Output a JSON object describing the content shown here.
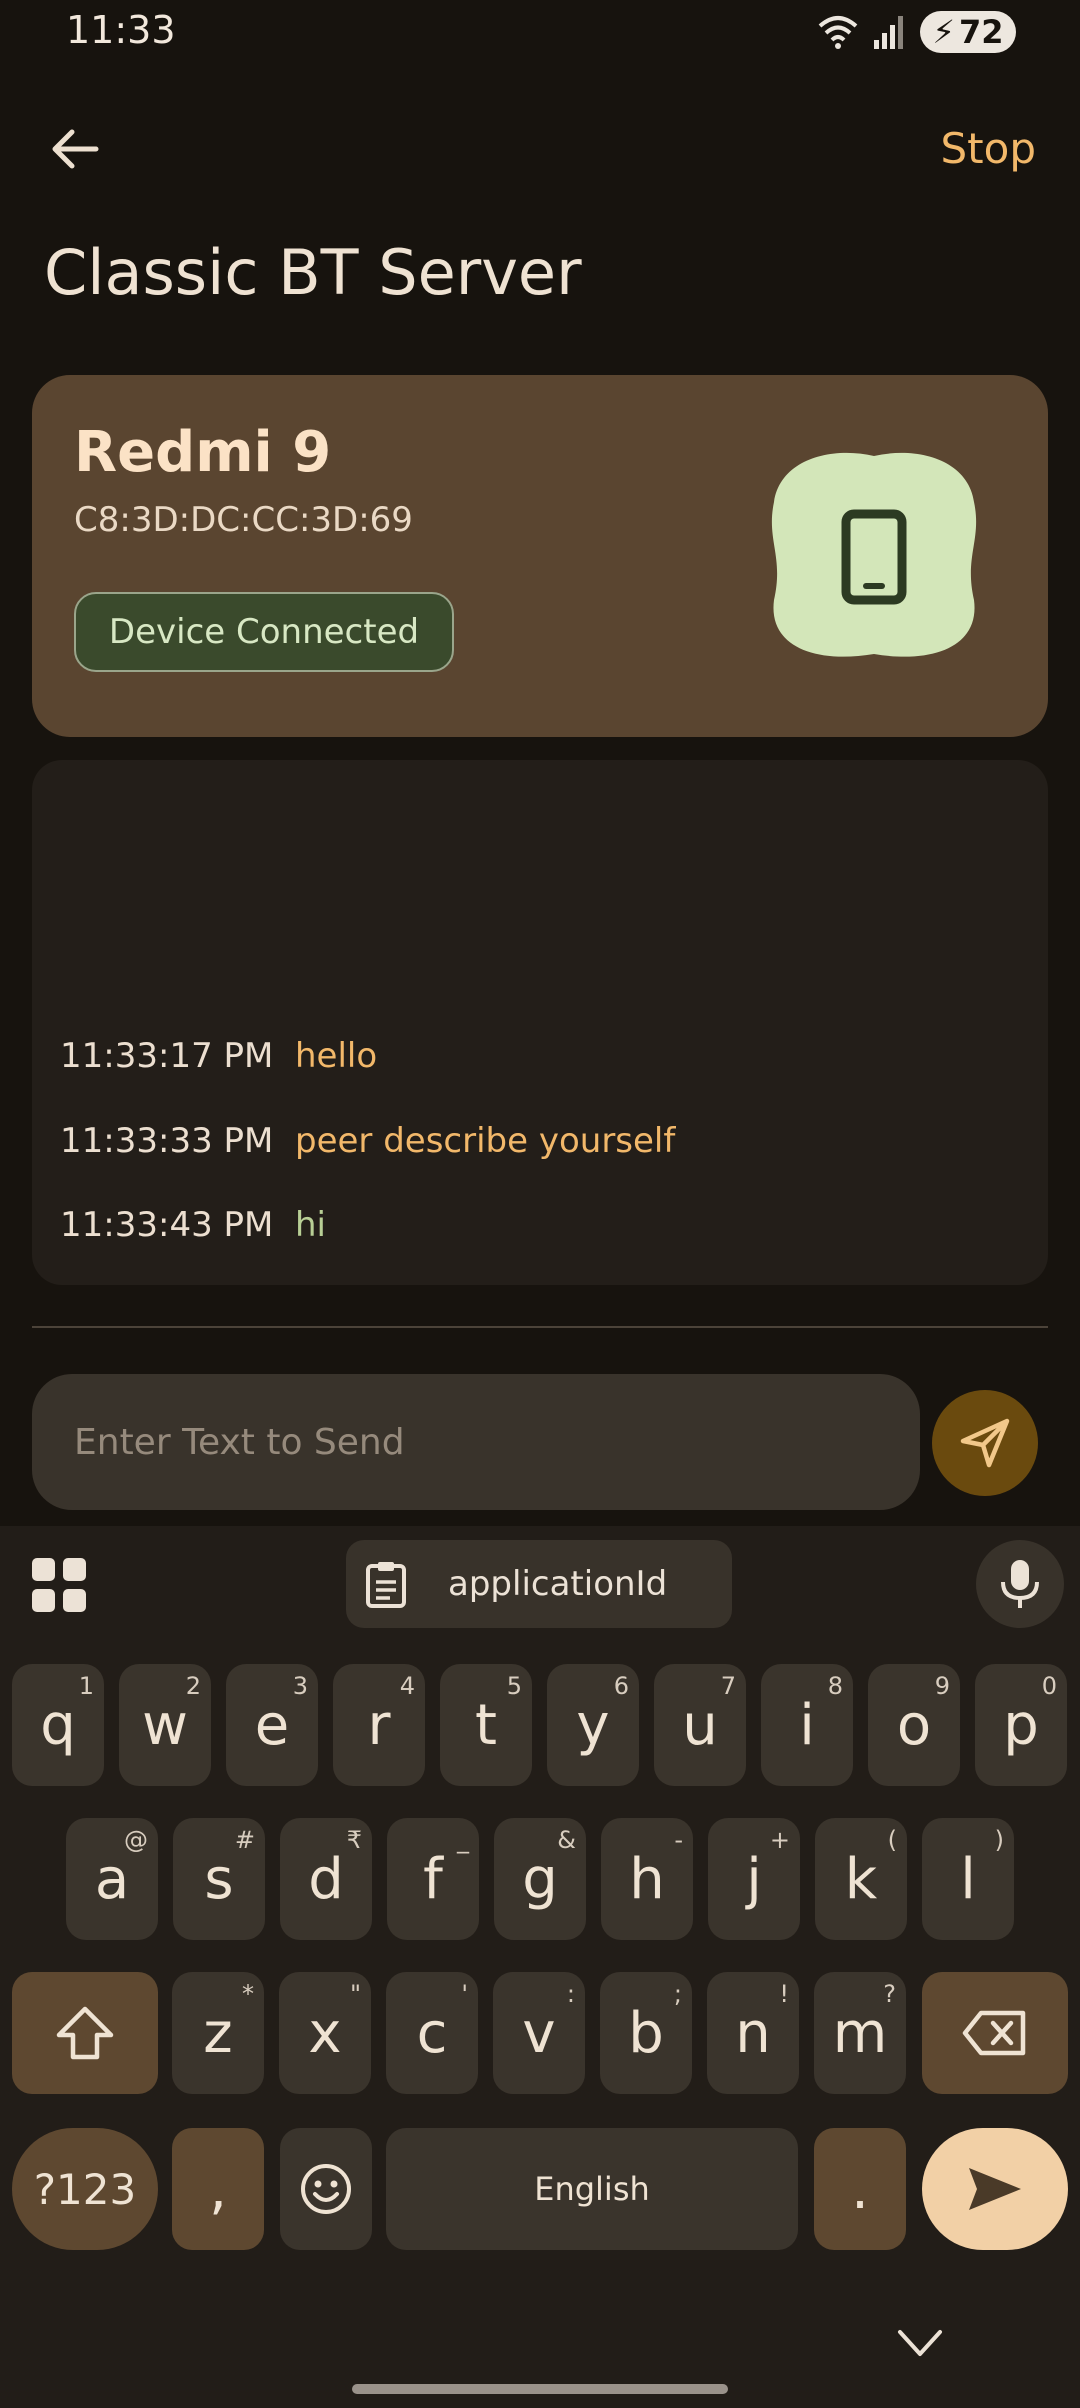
{
  "status_bar": {
    "time": "11:33",
    "battery": "72"
  },
  "app_bar": {
    "title": "Classic BT Server",
    "stop_label": "Stop",
    "back_icon": "arrow-back-icon"
  },
  "device": {
    "name": "Redmi 9",
    "mac": "C8:3D:DC:CC:3D:69",
    "status": "Device Connected",
    "icon": "smartphone-icon"
  },
  "log": [
    {
      "time": "11:33:17 PM",
      "message": "hello",
      "direction": "out"
    },
    {
      "time": "11:33:33 PM",
      "message": "peer describe yourself",
      "direction": "out"
    },
    {
      "time": "11:33:43 PM",
      "message": "hi",
      "direction": "in"
    }
  ],
  "input": {
    "placeholder": "Enter Text to Send",
    "value": ""
  },
  "keyboard": {
    "clipboard_suggestion": "applicationId",
    "row1": [
      {
        "k": "q",
        "s": "1"
      },
      {
        "k": "w",
        "s": "2"
      },
      {
        "k": "e",
        "s": "3"
      },
      {
        "k": "r",
        "s": "4"
      },
      {
        "k": "t",
        "s": "5"
      },
      {
        "k": "y",
        "s": "6"
      },
      {
        "k": "u",
        "s": "7"
      },
      {
        "k": "i",
        "s": "8"
      },
      {
        "k": "o",
        "s": "9"
      },
      {
        "k": "p",
        "s": "0"
      }
    ],
    "row2": [
      {
        "k": "a",
        "s": "@"
      },
      {
        "k": "s",
        "s": "#"
      },
      {
        "k": "d",
        "s": "₹"
      },
      {
        "k": "f",
        "s": "_"
      },
      {
        "k": "g",
        "s": "&"
      },
      {
        "k": "h",
        "s": "-"
      },
      {
        "k": "j",
        "s": "+"
      },
      {
        "k": "k",
        "s": "("
      },
      {
        "k": "l",
        "s": ")"
      }
    ],
    "row3": [
      {
        "k": "z",
        "s": "*"
      },
      {
        "k": "x",
        "s": "\""
      },
      {
        "k": "c",
        "s": "'"
      },
      {
        "k": "v",
        "s": ":"
      },
      {
        "k": "b",
        "s": ";"
      },
      {
        "k": "n",
        "s": "!"
      },
      {
        "k": "m",
        "s": "?"
      }
    ],
    "symbols_label": "?123",
    "comma": ",",
    "space_label": "English",
    "period": "."
  },
  "colors": {
    "accent": "#f2b86a",
    "card": "#5a4530",
    "incoming": "#b8cf95"
  }
}
